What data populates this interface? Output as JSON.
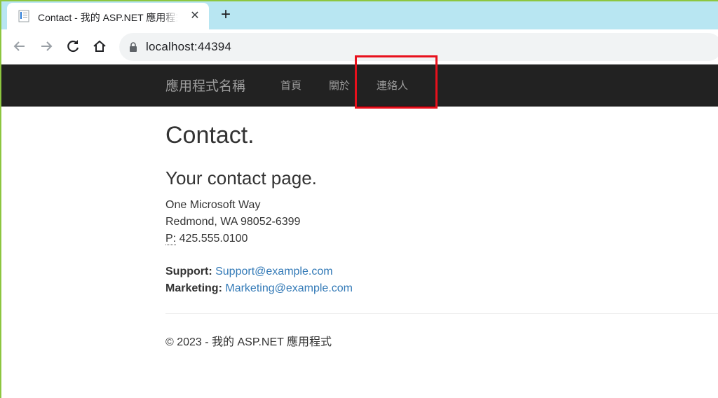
{
  "browser": {
    "tab_title": "Contact - 我的 ASP.NET 應用程式",
    "close_glyph": "✕",
    "new_tab_glyph": "+",
    "url": "localhost:44394"
  },
  "navbar": {
    "brand": "應用程式名稱",
    "links": [
      "首頁",
      "關於",
      "連絡人"
    ],
    "highlight_color": "#e8101c"
  },
  "page": {
    "title": "Contact.",
    "subtitle": "Your contact page.",
    "address": {
      "line1": "One Microsoft Way",
      "line2": "Redmond, WA 98052-6399",
      "phone_label": "P:",
      "phone": "425.555.0100"
    },
    "support": {
      "label": "Support:",
      "email": "Support@example.com"
    },
    "marketing": {
      "label": "Marketing:",
      "email": "Marketing@example.com"
    }
  },
  "footer": {
    "text": "© 2023 - 我的 ASP.NET 應用程式"
  },
  "colors": {
    "navbar_bg": "#222222",
    "link": "#337ab7",
    "tabstrip": "#b8e6f2"
  }
}
